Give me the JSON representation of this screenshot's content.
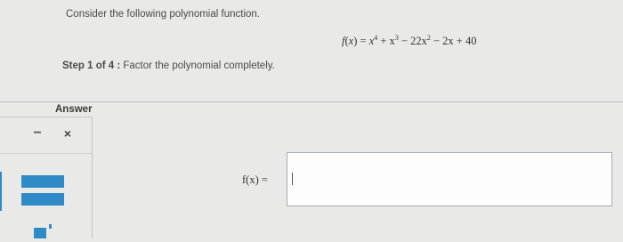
{
  "question": {
    "prompt": "Consider the following polynomial function.",
    "function_lhs": "f(x) = ",
    "function_rhs_parts": [
      "x",
      "4",
      " + x",
      "3",
      " − 22x",
      "2",
      " − 2x + 40"
    ]
  },
  "step": {
    "label": "Step 1 of 4 :",
    "instruction": "Factor the polynomial completely."
  },
  "answer": {
    "label": "Answer",
    "input_label": "f(x) =",
    "input_value": ""
  },
  "toolbar": {
    "minus_symbol": "−",
    "close_symbol": "×"
  },
  "colors": {
    "accent": "#2f8bc8",
    "background": "#e9e9e7"
  }
}
